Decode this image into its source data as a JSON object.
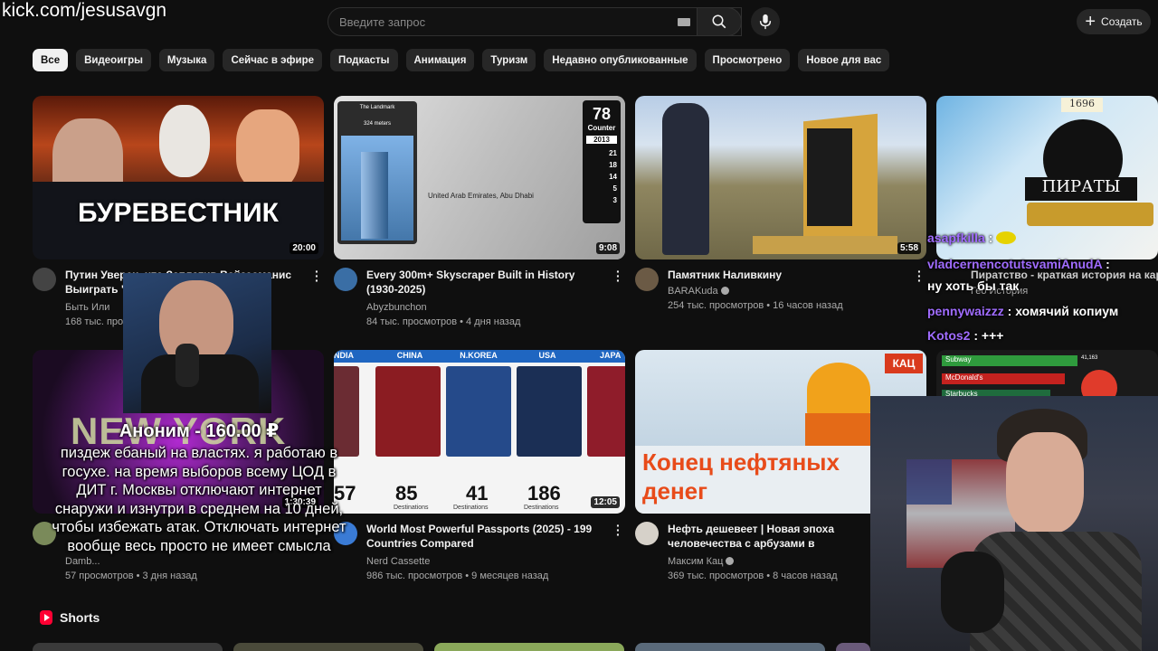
{
  "watermark": "kick.com/jesusavgn",
  "search": {
    "placeholder": "Введите запрос"
  },
  "header": {
    "create_label": "Создать"
  },
  "chips": [
    "Все",
    "Видеоигры",
    "Музыка",
    "Сейчас в эфире",
    "Подкасты",
    "Анимация",
    "Туризм",
    "Недавно опубликованные",
    "Просмотрено",
    "Новое для вас"
  ],
  "videos": [
    {
      "title": "Путин Уверен, что Заплатив Вайзсоманис Выиграть \"...\" ...",
      "channel": "Быть Или",
      "meta": "168 тыс. просм...",
      "duration": "20:00",
      "thumb_text": "БУРЕВЕСТНИК"
    },
    {
      "title": "Every 300m+ Skyscraper Built in History (1930-2025)",
      "channel": "Abyzbunchon",
      "meta": "84 тыс. просмотров • 4 дня назад",
      "duration": "9:08",
      "thumb_text": "United Arab Emirates, Abu Dhabi",
      "counter_num": "78",
      "counter_label": "Counter",
      "counter_year": "2013",
      "counter_values": [
        "21",
        "18",
        "14",
        "5",
        "3"
      ],
      "landmark": "The Landmark",
      "meters": "324 meters"
    },
    {
      "title": "Памятник Наливкину",
      "channel": "BARAKuda",
      "meta": "254 тыс. просмотров • 16 часов назад",
      "duration": "5:58"
    },
    {
      "title": "Пиратство - краткая история на карт",
      "channel": "Гео История",
      "meta": "",
      "duration": "",
      "thumb_text": "ПИРАТЫ",
      "year": "1696"
    },
    {
      "title": "",
      "channel": "Damb...",
      "meta": "57 просмотров • 3 дня назад",
      "duration": "1:30:39",
      "thumb_text": "NEW YORK"
    },
    {
      "title": "World Most Powerful Passports (2025) - 199 Countries Compared",
      "channel": "Nerd Cassette",
      "meta": "986 тыс. просмотров • 9 месяцев назад",
      "duration": "12:05",
      "countries": [
        "NDIA",
        "CHINA",
        "N.KOREA",
        "USA",
        "JAPA"
      ],
      "numbers": [
        "57",
        "85",
        "41",
        "186",
        ""
      ],
      "dest_label": "Destinations"
    },
    {
      "title": "Нефть дешевеет | Новая эпоха человечества с арбузами в стаканчиках (English subt",
      "channel": "Максим Кац",
      "meta": "369 тыс. просмотров • 8 часов назад",
      "duration": "",
      "thumb_text": "Конец нефтяных денег",
      "badge": "КАЦ"
    },
    {
      "title": "",
      "channel": "",
      "meta": "",
      "duration": "",
      "ranks": [
        "Subway",
        "McDonald's",
        "Starbucks"
      ],
      "rank_value": "41,163"
    }
  ],
  "shorts_label": "Shorts",
  "donation": {
    "title": "Аноним - 160.00 ₽",
    "text": "пиздеж ебаный на властях. я работаю в госухе. на время выборов всему ЦОД в ДИТ г. Москвы отключают интернет снаружи и изнутри в среднем на 10 дней, чтобы избежать атак. Отключать интернет вообще весь просто не имеет смысла"
  },
  "chat": [
    {
      "user": "asapfkilla",
      "msg": " : ",
      "emote": true
    },
    {
      "user": "vladcernencotutsvamiAnudA",
      "msg": " :"
    },
    {
      "user": "",
      "msg": "ну хоть бы так"
    },
    {
      "user": "pennywaizzz",
      "msg": " : хомячий копиум"
    },
    {
      "user": "Kotos2",
      "msg": " : +++"
    }
  ],
  "colors": {
    "chat_user": "#a06cff",
    "chip_active_bg": "#f1f1f1",
    "shorts_red": "#ff0033"
  }
}
